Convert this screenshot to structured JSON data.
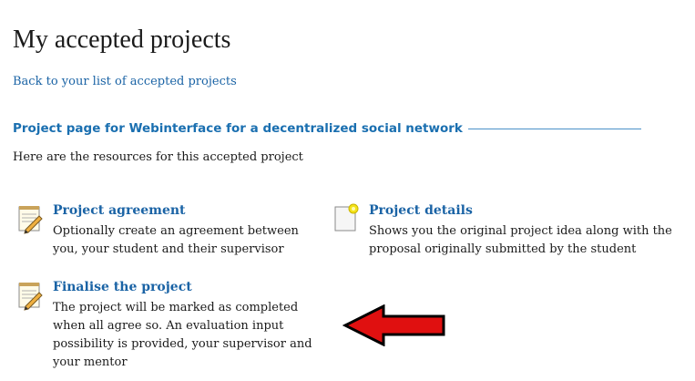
{
  "page": {
    "title": "My accepted projects",
    "back_link": "Back to your list of accepted projects",
    "section_heading": "Project page for Webinterface for a decentralized social network",
    "intro": "Here are the resources for this accepted project"
  },
  "cards": [
    {
      "title": "Project agreement",
      "description": "Optionally create an agreement between you, your student and their supervisor",
      "icon": "notepad-pencil-icon"
    },
    {
      "title": "Project details",
      "description": "Shows you the original project idea along with the proposal originally submitted by the student",
      "icon": "document-lightbulb-icon"
    },
    {
      "title": "Finalise the project",
      "description": "The project will be marked as completed when all agree so. An evaluation input possibility is provided, your supervisor and your mentor",
      "icon": "notepad-pencil-icon"
    }
  ],
  "annotation": {
    "arrow_color": "#e01010",
    "arrow_icon": "red-arrow-left-icon"
  },
  "colors": {
    "link": "#1a63a5",
    "heading": "#1a6fb0"
  }
}
